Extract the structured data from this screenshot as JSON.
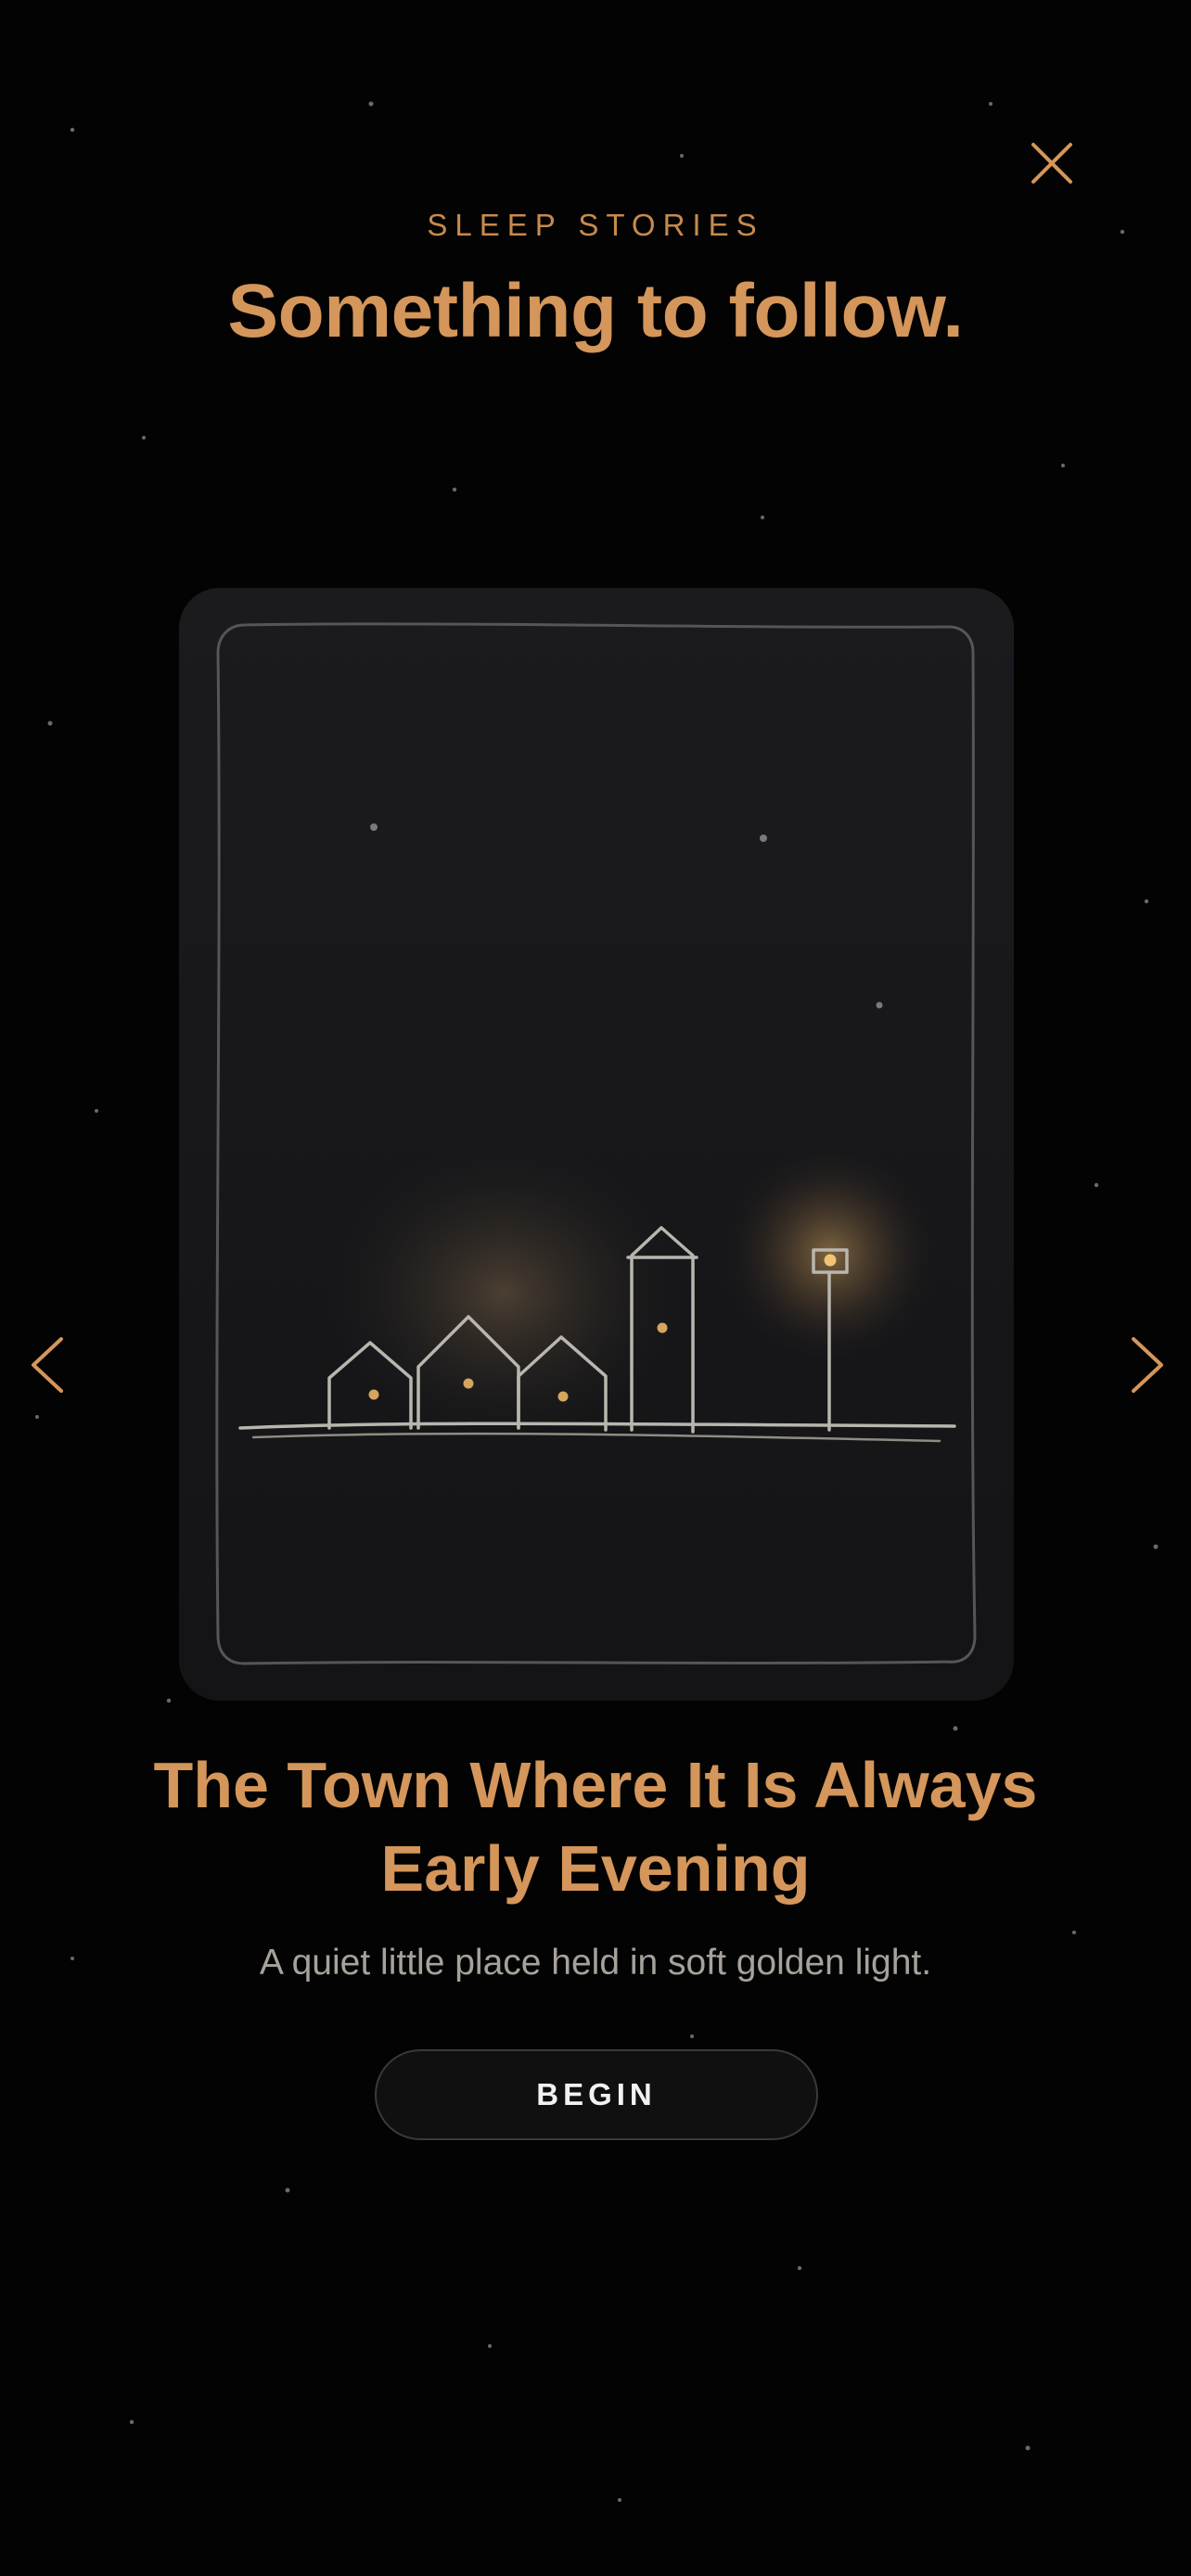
{
  "header": {
    "eyebrow": "SLEEP STORIES",
    "headline": "Something to follow.",
    "close_icon": "close-icon"
  },
  "story": {
    "title": "The Town Where It Is Always Early Evening",
    "description": "A quiet little place held in soft golden light.",
    "illustration": "town-at-dusk-illustration"
  },
  "actions": {
    "begin_label": "BEGIN"
  },
  "navigation": {
    "prev_icon": "chevron-left-icon",
    "next_icon": "chevron-right-icon"
  },
  "colors": {
    "background": "#030303",
    "accent": "#d4965a",
    "card": "#18181b",
    "muted_text": "#a6a29b"
  }
}
